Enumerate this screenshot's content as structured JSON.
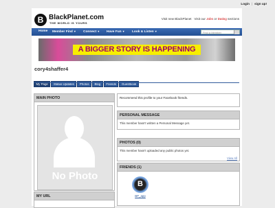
{
  "topbar": {
    "login": "Login",
    "signup": "sign up!"
  },
  "header": {
    "logo_letter": "B",
    "logo_name": "BlackPlanet.com",
    "logo_tagline": "THE WORLD IS YOURS",
    "visit_prefix": "Visit new BlackPlanet",
    "visit_middle": "Visit our",
    "jobs_link": "Jobs",
    "or": "or",
    "dating_link": "Dating",
    "visit_suffix": "sections"
  },
  "nav": {
    "items": [
      "Home",
      "Member Find",
      "Connect",
      "Have Fun",
      "Look & Listen"
    ],
    "search_placeholder": "Find a Member"
  },
  "banner": {
    "text": "A BIGGER STORY IS HAPPENING"
  },
  "profile": {
    "username": "cory4shaffer4"
  },
  "tabs": [
    "My Page",
    "Status Updates",
    "Photos",
    "Blog",
    "Friends",
    "Guestbook"
  ],
  "main_photo": {
    "title": "MAIN PHOTO",
    "placeholder": "No Photo"
  },
  "my_url": {
    "title": "MY URL"
  },
  "recommend": {
    "text": "Recommend this profile to your Facebook friends."
  },
  "personal_message": {
    "title": "PERSONAL MESSAGE",
    "text": "This member hasn't written a Personal Message yet."
  },
  "photos": {
    "title": "PHOTOS (0)",
    "text": "This member hasn't uploaded any public photos yet.",
    "view_all": "View All"
  },
  "friends": {
    "title": "FRIENDS (1)",
    "items": [
      {
        "avatar_letter": "B",
        "name": "BP_app"
      }
    ]
  },
  "colors": {
    "nav": "#2f5a9a",
    "accent": "#cc0000",
    "banner_text": "#a0006a",
    "banner_strip": "#f7ee00"
  }
}
